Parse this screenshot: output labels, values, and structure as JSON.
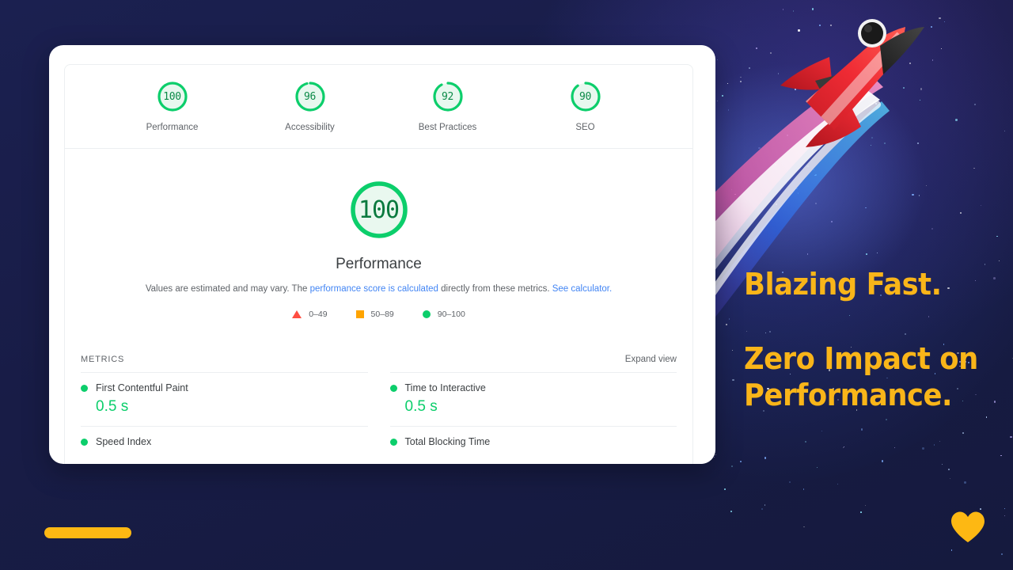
{
  "report": {
    "category_scores": [
      {
        "score": "100",
        "label": "Performance",
        "value": 100
      },
      {
        "score": "96",
        "label": "Accessibility",
        "value": 96
      },
      {
        "score": "92",
        "label": "Best Practices",
        "value": 92
      },
      {
        "score": "90",
        "label": "SEO",
        "value": 90
      }
    ],
    "hero": {
      "score": "100",
      "title": "Performance",
      "desc_part1": "Values are estimated and may vary. The ",
      "link1": "performance score is calculated",
      "desc_part2": " directly from these metrics. ",
      "link2": "See calculator."
    },
    "legend": [
      {
        "shape": "triangle",
        "range": "0–49",
        "color": "#ff4e42"
      },
      {
        "shape": "square",
        "range": "50–89",
        "color": "#ffa400"
      },
      {
        "shape": "circle",
        "range": "90–100",
        "color": "#0cce6b"
      }
    ],
    "metrics": {
      "title": "METRICS",
      "expand_label": "Expand view",
      "left": [
        {
          "name": "First Contentful Paint",
          "value": "0.5 s",
          "status": "pass"
        },
        {
          "name": "Speed Index",
          "value": "",
          "status": "pass"
        }
      ],
      "right": [
        {
          "name": "Time to Interactive",
          "value": "0.5 s",
          "status": "pass"
        },
        {
          "name": "Total Blocking Time",
          "value": "",
          "status": "pass"
        }
      ]
    }
  },
  "marketing": {
    "line1": "Blazing Fast.",
    "line2": "Zero Impact on",
    "line3": "Performance."
  },
  "colors": {
    "background": "#191d4a",
    "accent_amber": "#fdb813",
    "score_green": "#0cce6b",
    "link_blue": "#4285f4"
  }
}
